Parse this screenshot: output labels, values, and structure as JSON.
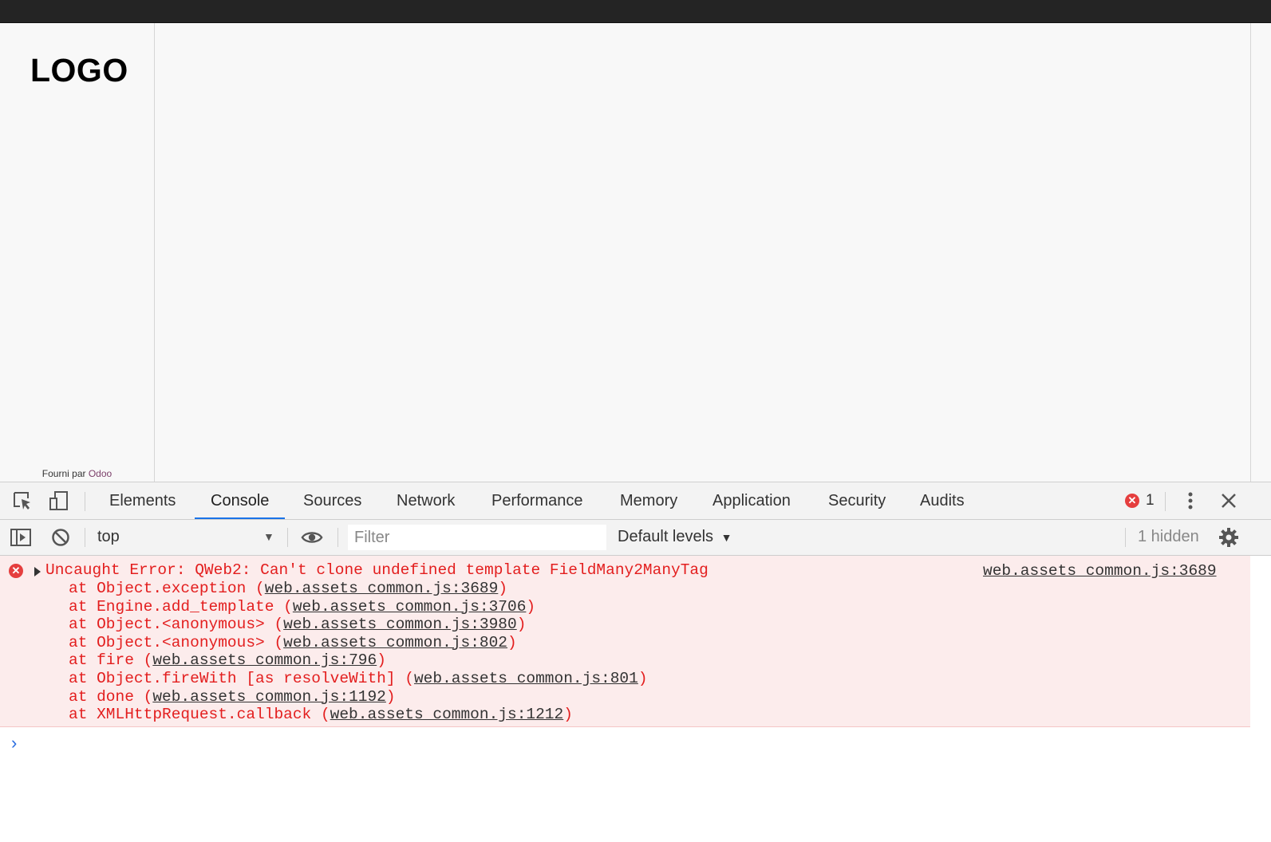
{
  "page": {
    "logo": "LOGO",
    "powered_prefix": "Fourni par",
    "powered_brand": "Odoo"
  },
  "devtools": {
    "tabs": [
      "Elements",
      "Console",
      "Sources",
      "Network",
      "Performance",
      "Memory",
      "Application",
      "Security",
      "Audits"
    ],
    "active_tab": "Console",
    "error_count": "1",
    "context": "top",
    "filter_placeholder": "Filter",
    "levels": "Default levels",
    "hidden": "1 hidden",
    "icons": [
      "inspect-icon",
      "device-toolbar-icon",
      "more-icon",
      "close-icon",
      "sidebar-toggle-icon",
      "clear-console-icon",
      "eye-icon",
      "gear-icon"
    ]
  },
  "console": {
    "error": {
      "message": "Uncaught Error: QWeb2: Can't clone undefined template FieldMany2ManyTag",
      "source": "web.assets_common.js:3689",
      "stack": [
        {
          "prefix": "at Object.exception (",
          "link": "web.assets_common.js:3689",
          "suffix": ")"
        },
        {
          "prefix": "at Engine.add_template (",
          "link": "web.assets_common.js:3706",
          "suffix": ")"
        },
        {
          "prefix": "at Object.<anonymous> (",
          "link": "web.assets_common.js:3980",
          "suffix": ")"
        },
        {
          "prefix": "at Object.<anonymous> (",
          "link": "web.assets_common.js:802",
          "suffix": ")"
        },
        {
          "prefix": "at fire (",
          "link": "web.assets_common.js:796",
          "suffix": ")"
        },
        {
          "prefix": "at Object.fireWith [as resolveWith] (",
          "link": "web.assets_common.js:801",
          "suffix": ")"
        },
        {
          "prefix": "at done (",
          "link": "web.assets_common.js:1192",
          "suffix": ")"
        },
        {
          "prefix": "at XMLHttpRequest.callback (",
          "link": "web.assets_common.js:1212",
          "suffix": ")"
        }
      ]
    },
    "prompt": "›"
  },
  "colors": {
    "error_text": "#e31e1e",
    "error_bg": "#fcecec",
    "active_tab_underline": "#1a73e8",
    "brand": "#7c3f6a"
  }
}
